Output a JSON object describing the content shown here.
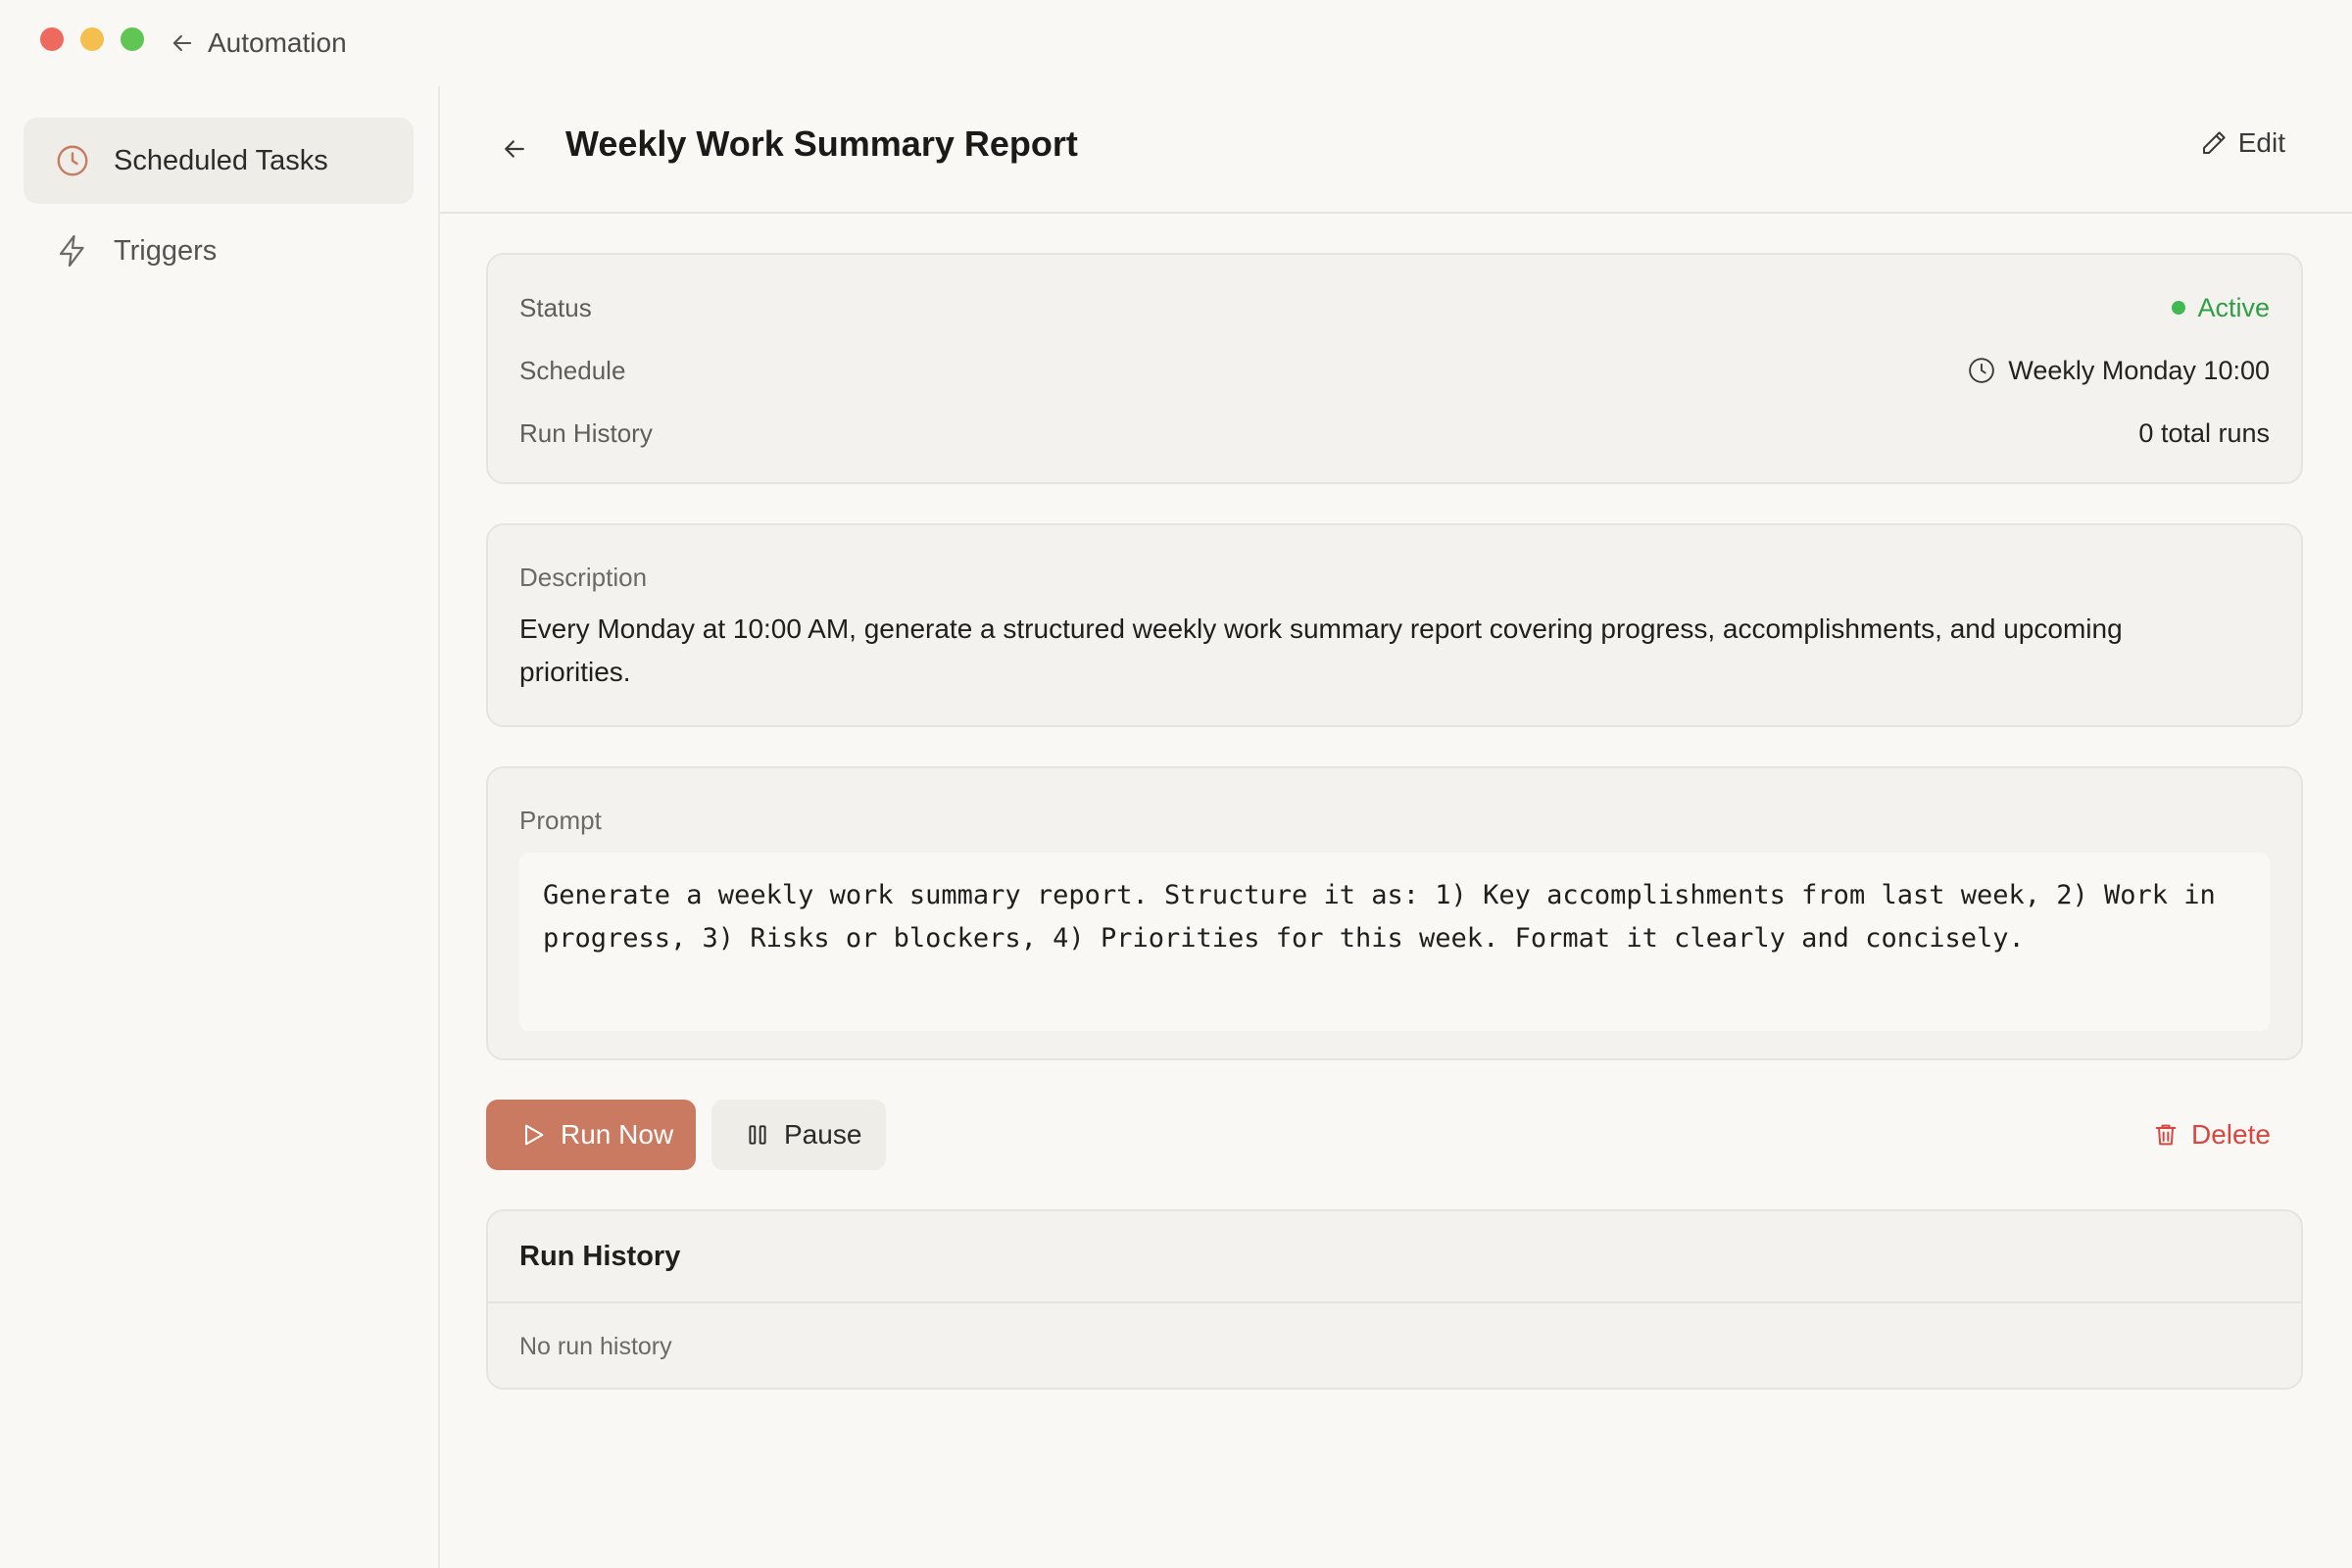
{
  "titlebar": {
    "back_label": "Automation"
  },
  "sidebar": {
    "items": [
      {
        "label": "Scheduled Tasks",
        "icon": "clock-icon",
        "active": true
      },
      {
        "label": "Triggers",
        "icon": "lightning-icon",
        "active": false
      }
    ]
  },
  "header": {
    "title": "Weekly Work Summary Report",
    "edit_label": "Edit"
  },
  "status": {
    "status_label": "Status",
    "status_value": "Active",
    "schedule_label": "Schedule",
    "schedule_value": "Weekly Monday 10:00",
    "history_label": "Run History",
    "history_value": "0 total runs"
  },
  "description": {
    "label": "Description",
    "text": "Every Monday at 10:00 AM, generate a structured weekly work summary report covering progress, accomplishments, and upcoming priorities."
  },
  "prompt": {
    "label": "Prompt",
    "text": "Generate a weekly work summary report. Structure it as: 1) Key accomplishments from last week, 2) Work in progress, 3) Risks or blockers, 4) Priorities for this week. Format it clearly and concisely."
  },
  "actions": {
    "run_label": "Run Now",
    "pause_label": "Pause",
    "delete_label": "Delete"
  },
  "run_history": {
    "title": "Run History",
    "empty_text": "No run history"
  },
  "colors": {
    "accent": "#c97a60",
    "active_green": "#2f9e44",
    "danger": "#d9463f",
    "background": "#f9f8f5"
  }
}
